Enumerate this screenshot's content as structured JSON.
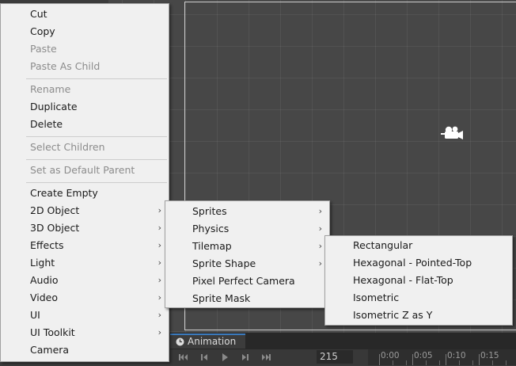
{
  "context_menu": {
    "items": [
      {
        "label": "Cut",
        "enabled": true
      },
      {
        "label": "Copy",
        "enabled": true
      },
      {
        "label": "Paste",
        "enabled": false
      },
      {
        "label": "Paste As Child",
        "enabled": false
      },
      {
        "label": "Rename",
        "enabled": false
      },
      {
        "label": "Duplicate",
        "enabled": true
      },
      {
        "label": "Delete",
        "enabled": true
      },
      {
        "label": "Select Children",
        "enabled": false
      },
      {
        "label": "Set as Default Parent",
        "enabled": false
      },
      {
        "label": "Create Empty",
        "enabled": true
      },
      {
        "label": "2D Object",
        "enabled": true,
        "submenu": true
      },
      {
        "label": "3D Object",
        "enabled": true,
        "submenu": true
      },
      {
        "label": "Effects",
        "enabled": true,
        "submenu": true
      },
      {
        "label": "Light",
        "enabled": true,
        "submenu": true
      },
      {
        "label": "Audio",
        "enabled": true,
        "submenu": true
      },
      {
        "label": "Video",
        "enabled": true,
        "submenu": true
      },
      {
        "label": "UI",
        "enabled": true,
        "submenu": true
      },
      {
        "label": "UI Toolkit",
        "enabled": true,
        "submenu": true
      },
      {
        "label": "Camera",
        "enabled": true
      }
    ]
  },
  "submenu_2d": {
    "items": [
      {
        "label": "Sprites",
        "submenu": true
      },
      {
        "label": "Physics",
        "submenu": true
      },
      {
        "label": "Tilemap",
        "submenu": true
      },
      {
        "label": "Sprite Shape",
        "submenu": true
      },
      {
        "label": "Pixel Perfect Camera",
        "submenu": false
      },
      {
        "label": "Sprite Mask",
        "submenu": false
      }
    ]
  },
  "submenu_tilemap": {
    "items": [
      {
        "label": "Rectangular"
      },
      {
        "label": "Hexagonal - Pointed-Top"
      },
      {
        "label": "Hexagonal - Flat-Top"
      },
      {
        "label": "Isometric"
      },
      {
        "label": "Isometric Z as Y"
      }
    ]
  },
  "animation": {
    "tab_label": "Animation",
    "frame": "215",
    "timeline_ticks": [
      "0:00",
      "0:05",
      "0:10",
      "0:15"
    ]
  },
  "icons": {
    "submenu_arrow": "chevron-right-icon",
    "scene_camera": "camera-icon",
    "animation_tab": "clock-icon"
  },
  "colors": {
    "menu_bg": "#f0f0f0",
    "menu_text": "#1a1a1a",
    "menu_disabled": "#8c8c8c",
    "scene_bg": "#474747",
    "accent": "#3a79bb"
  }
}
